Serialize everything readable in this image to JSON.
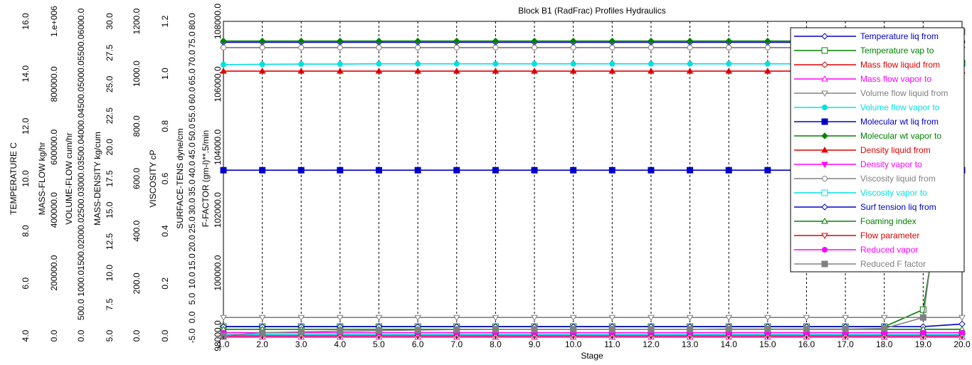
{
  "chart_data": {
    "type": "line",
    "title": "Block B1 (RadFrac) Profiles Hydraulics",
    "xlabel": "Stage",
    "x_ticks": [
      "1.0",
      "2.0",
      "3.0",
      "4.0",
      "5.0",
      "6.0",
      "7.0",
      "8.0",
      "9.0",
      "10.0",
      "11.0",
      "12.0",
      "13.0",
      "14.0",
      "15.0",
      "16.0",
      "17.0",
      "18.0",
      "19.0",
      "20.0"
    ],
    "xlim": [
      1,
      20
    ],
    "grid": "vertical dashed",
    "legend_position": "right",
    "axes": [
      {
        "label": "TEMPERATURE C",
        "ticks": [
          "4.0",
          "6.0",
          "8.0",
          "10.0",
          "12.0",
          "14.0",
          "16.0"
        ]
      },
      {
        "label": "MASS-FLOW kg/hr",
        "ticks": [
          "0.0",
          "200000.0",
          "400000.0",
          "600000.0",
          "800000.0",
          "1.e+006"
        ]
      },
      {
        "label": "VOLUME-FLOW cum/hr",
        "ticks": [
          "0.0",
          "500.0",
          "1000.0",
          "1500.0",
          "2000.0",
          "2500.0",
          "3000.0",
          "3500.0",
          "4000.0",
          "4500.0",
          "5000.0",
          "5500.0",
          "6000.0"
        ]
      },
      {
        "label": "MASS-DENSITY kg/cum",
        "ticks": [
          "5.0",
          "7.5",
          "10.0",
          "12.5",
          "15.0",
          "17.5",
          "20.0",
          "22.5",
          "25.0",
          "27.5",
          "30.0"
        ]
      },
      {
        "label": "",
        "ticks": [
          "0.0",
          "200.0",
          "400.0",
          "600.0",
          "800.0",
          "1000.0",
          "1200.0"
        ]
      },
      {
        "label": "VISCOSITY cP",
        "ticks": [
          "0.0",
          "0.2",
          "0.4",
          "0.6",
          "0.8",
          "1.0",
          "1.2"
        ]
      },
      {
        "label": "SURFACE-TENS dyne/cm",
        "ticks": [
          "-5.0",
          "0.0",
          "5.0",
          "10.0",
          "15.0",
          "20.0",
          "25.0",
          "30.0",
          "35.0",
          "40.0",
          "45.0",
          "50.0",
          "55.0",
          "60.0",
          "65.0",
          "70.0",
          "75.0",
          "80.0"
        ]
      },
      {
        "label": "F-FACTOR (gm-l)**.5/min",
        "ticks": [
          "98000.0",
          "100000.0",
          "102000.0",
          "104000.0",
          "106000.0",
          "108000.0"
        ]
      }
    ],
    "series": [
      {
        "name": "Temperature liq from",
        "color": "#0000c8",
        "marker": "diamond-open",
        "values": [
          1.12,
          1.12,
          1.12,
          1.12,
          1.12,
          1.12,
          1.12,
          1.12,
          1.12,
          1.12,
          1.12,
          1.12,
          1.12,
          1.12,
          1.12,
          1.12,
          1.12,
          1.12,
          1.12,
          1.12
        ]
      },
      {
        "name": "Temperature vap to",
        "color": "#008000",
        "marker": "square-open",
        "values": [
          0.035,
          0.035,
          0.035,
          0.035,
          0.035,
          0.035,
          0.035,
          0.035,
          0.035,
          0.035,
          0.035,
          0.035,
          0.035,
          0.035,
          0.035,
          0.035,
          0.035,
          0.035,
          0.1,
          1.04
        ]
      },
      {
        "name": "Mass flow liquid from",
        "color": "#e00000",
        "marker": "diamond-open",
        "values": [
          1.1,
          1.1,
          1.1,
          1.1,
          1.1,
          1.1,
          1.1,
          1.1,
          1.1,
          1.1,
          1.1,
          1.1,
          1.1,
          1.1,
          1.1,
          1.1,
          1.1,
          1.1,
          1.1,
          1.1
        ]
      },
      {
        "name": "Mass flow vapor to",
        "color": "#ff00ff",
        "marker": "triangle-open",
        "values": [
          -0.005,
          -0.005,
          -0.005,
          -0.005,
          -0.005,
          -0.005,
          -0.005,
          -0.005,
          -0.005,
          -0.005,
          -0.005,
          -0.005,
          -0.005,
          -0.005,
          -0.005,
          -0.005,
          -0.005,
          -0.005,
          -0.005,
          -0.005
        ]
      },
      {
        "name": "Volume flow liquid from",
        "color": "#808080",
        "marker": "triangle-down-open",
        "values": [
          0.07,
          0.07,
          0.07,
          0.07,
          0.07,
          0.07,
          0.07,
          0.07,
          0.07,
          0.07,
          0.07,
          0.07,
          0.07,
          0.07,
          0.07,
          0.07,
          0.07,
          0.07,
          0.07,
          0.07
        ]
      },
      {
        "name": "Volume flow vapor to",
        "color": "#00e0e0",
        "marker": "circle-filled",
        "values": [
          1.035,
          1.036,
          1.037,
          1.037,
          1.038,
          1.038,
          1.038,
          1.038,
          1.038,
          1.038,
          1.038,
          1.038,
          1.038,
          1.038,
          1.038,
          1.038,
          1.038,
          1.038,
          1.038,
          1.038
        ]
      },
      {
        "name": "Molecular wt liq from",
        "color": "#0000c8",
        "marker": "square-filled",
        "values": [
          0.632,
          0.632,
          0.632,
          0.632,
          0.632,
          0.632,
          0.632,
          0.632,
          0.632,
          0.632,
          0.632,
          0.632,
          0.632,
          0.632,
          0.632,
          0.632,
          0.632,
          0.632,
          0.632,
          0.632
        ]
      },
      {
        "name": "Molecular wt vapor to",
        "color": "#008000",
        "marker": "diamond-filled",
        "values": [
          1.125,
          1.125,
          1.125,
          1.125,
          1.125,
          1.125,
          1.125,
          1.125,
          1.125,
          1.125,
          1.125,
          1.125,
          1.125,
          1.125,
          1.125,
          1.125,
          1.125,
          1.125,
          1.125,
          1.125
        ]
      },
      {
        "name": "Density liquid from",
        "color": "#e00000",
        "marker": "triangle-filled",
        "values": [
          1.01,
          1.01,
          1.01,
          1.01,
          1.01,
          1.01,
          1.01,
          1.01,
          1.01,
          1.01,
          1.01,
          1.01,
          1.01,
          1.01,
          1.01,
          1.01,
          1.01,
          1.01,
          1.01,
          1.01
        ]
      },
      {
        "name": "Density vapor to",
        "color": "#ff00ff",
        "marker": "triangle-down-filled",
        "values": [
          0.005,
          0.005,
          0.005,
          0.005,
          0.005,
          0.005,
          0.005,
          0.005,
          0.005,
          0.005,
          0.005,
          0.005,
          0.005,
          0.005,
          0.005,
          0.005,
          0.005,
          0.005,
          0.005,
          0.005
        ]
      },
      {
        "name": "Viscosity liquid from",
        "color": "#808080",
        "marker": "circle-open",
        "values": [
          1.1,
          1.1,
          1.1,
          1.1,
          1.1,
          1.1,
          1.1,
          1.1,
          1.1,
          1.1,
          1.1,
          1.1,
          1.1,
          1.1,
          1.1,
          1.1,
          1.1,
          1.1,
          1.1,
          1.1
        ]
      },
      {
        "name": "Viscosity vapor to",
        "color": "#00e0e0",
        "marker": "square-open",
        "values": [
          0.005,
          0.005,
          0.005,
          0.005,
          0.005,
          0.005,
          0.005,
          0.005,
          0.005,
          0.005,
          0.005,
          0.005,
          0.005,
          0.005,
          0.005,
          0.005,
          0.005,
          0.005,
          0.005,
          0.005
        ]
      },
      {
        "name": "Surf tension liq from",
        "color": "#0000c8",
        "marker": "diamond-open",
        "values": [
          0.035,
          0.035,
          0.035,
          0.035,
          0.035,
          0.035,
          0.035,
          0.035,
          0.035,
          0.035,
          0.035,
          0.035,
          0.035,
          0.035,
          0.035,
          0.035,
          0.035,
          0.035,
          0.035,
          0.045
        ]
      },
      {
        "name": "Foaming index",
        "color": "#008000",
        "marker": "triangle-open",
        "values": [
          0.025,
          0.025,
          0.025,
          0.025,
          0.025,
          0.025,
          0.025,
          0.025,
          0.025,
          0.025,
          0.025,
          0.025,
          0.025,
          0.025,
          0.025,
          0.025,
          0.025,
          0.025,
          0.025,
          0.025
        ]
      },
      {
        "name": "Flow parameter",
        "color": "#e00000",
        "marker": "triangle-down-open",
        "values": [
          0.0,
          0.0,
          0.0,
          0.0,
          0.0,
          0.0,
          0.0,
          0.0,
          0.0,
          0.0,
          0.0,
          0.0,
          0.0,
          0.0,
          0.0,
          0.0,
          0.0,
          0.0,
          0.0,
          0.0
        ]
      },
      {
        "name": "Reduced vapor",
        "color": "#ff00ff",
        "marker": "circle-filled",
        "values": [
          0.012,
          0.012,
          0.012,
          0.012,
          0.012,
          0.012,
          0.012,
          0.012,
          0.012,
          0.012,
          0.012,
          0.012,
          0.012,
          0.012,
          0.012,
          0.012,
          0.012,
          0.012,
          0.012,
          0.012
        ]
      },
      {
        "name": "Reduced F factor",
        "color": "#808080",
        "marker": "square-filled",
        "values": [
          0.0,
          0.012,
          0.015,
          0.018,
          0.02,
          0.022,
          0.024,
          0.025,
          0.025,
          0.025,
          0.025,
          0.025,
          0.025,
          0.026,
          0.026,
          0.026,
          0.026,
          0.028,
          0.07,
          1.16
        ]
      }
    ]
  }
}
